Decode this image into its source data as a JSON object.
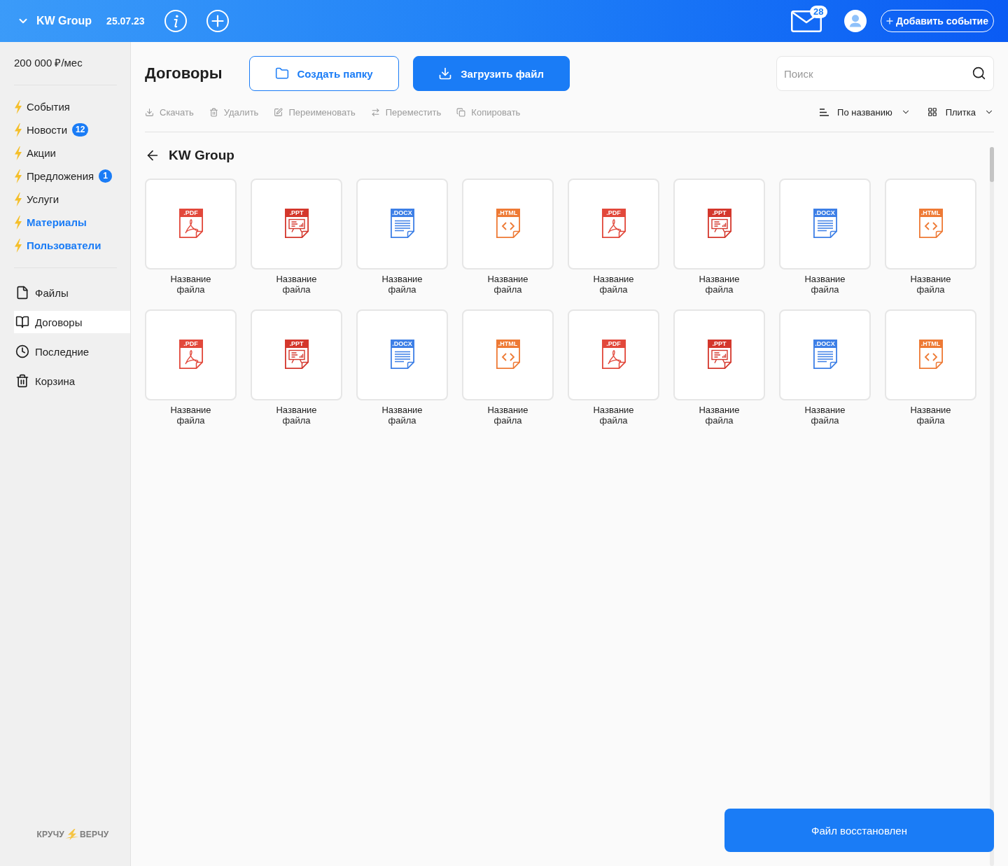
{
  "header": {
    "company": "KW Group",
    "date": "25.07.23",
    "mail_badge": "28",
    "add_event_button": "Добавить событие"
  },
  "sidebar": {
    "budget": "200 000 ₽/мес",
    "sections": [
      {
        "label": "События",
        "highlighted": false
      },
      {
        "label": "Новости",
        "highlighted": false,
        "badge": "12"
      },
      {
        "label": "Акции",
        "highlighted": false
      },
      {
        "label": "Предложения",
        "highlighted": false,
        "badge": "1"
      },
      {
        "label": "Услуги",
        "highlighted": false
      },
      {
        "label": "Материалы",
        "highlighted": true
      },
      {
        "label": "Пользователи",
        "highlighted": true
      }
    ],
    "nav": [
      {
        "kind": "files",
        "label": "Файлы",
        "selected": false
      },
      {
        "kind": "contracts",
        "label": "Договоры",
        "selected": true
      },
      {
        "kind": "recent",
        "label": "Последние",
        "selected": false
      },
      {
        "kind": "trash",
        "label": "Корзина",
        "selected": false
      }
    ],
    "logo": {
      "left": "КРУЧУ",
      "right": "ВЕРЧУ"
    }
  },
  "main": {
    "title": "Договоры",
    "create_folder_button": "Создать папку",
    "upload_button": "Загрузить файл",
    "search": {
      "placeholder": "Поиск"
    },
    "actions": [
      {
        "kind": "download",
        "label": "Скачать",
        "disabled": true
      },
      {
        "kind": "delete",
        "label": "Удалить",
        "disabled": true
      },
      {
        "kind": "rename",
        "label": "Переименовать",
        "disabled": true
      },
      {
        "kind": "move",
        "label": "Переместить",
        "disabled": true
      },
      {
        "kind": "copy",
        "label": "Копировать",
        "disabled": true
      }
    ],
    "sort": {
      "label": "По названию"
    },
    "view": {
      "label": "Плитка"
    },
    "breadcrumb": "KW Group",
    "files": [
      {
        "kind": "pdf",
        "extension": ".PDF",
        "name": "Название файла"
      },
      {
        "kind": "ppt",
        "extension": ".PPT",
        "name": "Название файла"
      },
      {
        "kind": "docx",
        "extension": ".DOCX",
        "name": "Название файла"
      },
      {
        "kind": "html",
        "extension": ".HTML",
        "name": "Название файла"
      },
      {
        "kind": "pdf",
        "extension": ".PDF",
        "name": "Название файла"
      },
      {
        "kind": "ppt",
        "extension": ".PPT",
        "name": "Название файла"
      },
      {
        "kind": "docx",
        "extension": ".DOCX",
        "name": "Название файла"
      },
      {
        "kind": "html",
        "extension": ".HTML",
        "name": "Название файла"
      },
      {
        "kind": "pdf",
        "extension": ".PDF",
        "name": "Название файла"
      },
      {
        "kind": "ppt",
        "extension": ".PPT",
        "name": "Название файла"
      },
      {
        "kind": "docx",
        "extension": ".DOCX",
        "name": "Название файла"
      },
      {
        "kind": "html",
        "extension": ".HTML",
        "name": "Название файла"
      },
      {
        "kind": "pdf",
        "extension": ".PDF",
        "name": "Название файла"
      },
      {
        "kind": "ppt",
        "extension": ".PPT",
        "name": "Название файла"
      },
      {
        "kind": "docx",
        "extension": ".DOCX",
        "name": "Название файла"
      },
      {
        "kind": "html",
        "extension": ".HTML",
        "name": "Название файла"
      }
    ]
  },
  "toast": "Файл восстановлен"
}
